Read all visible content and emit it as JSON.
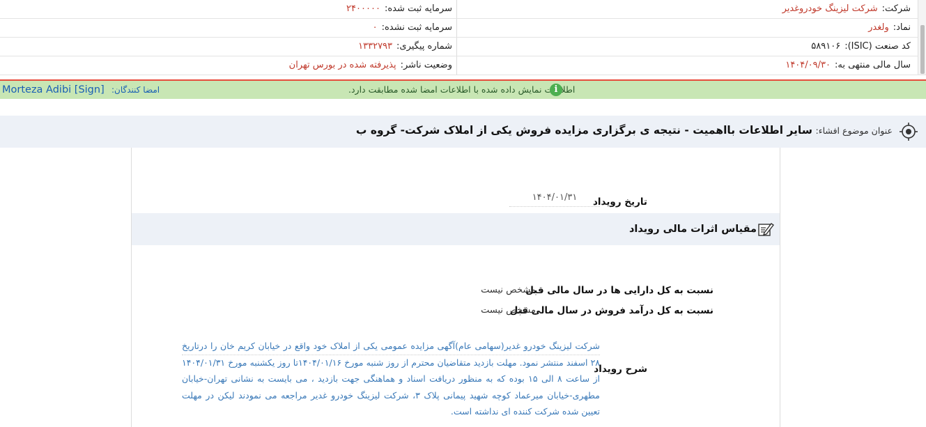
{
  "company_info": {
    "company": {
      "label": "شرکت:",
      "value": "شرکت لیزینگ خودروغدیر"
    },
    "registered_capital": {
      "label": "سرمایه ثبت شده:",
      "value": "۲۴۰۰۰۰۰"
    },
    "symbol": {
      "label": "نماد:",
      "value": "ولغدر"
    },
    "unregistered_capital": {
      "label": "سرمایه ثبت نشده:",
      "value": "۰"
    },
    "isic": {
      "label": "کد صنعت (ISIC):",
      "value": "۵۸۹۱۰۶"
    },
    "tracking_number": {
      "label": "شماره پیگیری:",
      "value": "۱۳۳۲۷۹۳"
    },
    "fiscal_year": {
      "label": "سال مالی منتهی به:",
      "value": "۱۴۰۴/۰۹/۳۰"
    },
    "publisher_status": {
      "label": "وضعیت ناشر:",
      "value": "پذیرفته شده در بورس تهران"
    }
  },
  "verification": {
    "message": "اطلاعات نمایش داده شده با اطلاعات امضا شده مطابقت دارد.",
    "signers_label": "امضا کنندگان:",
    "signer": "Morteza Adibi [Sign]"
  },
  "subject": {
    "label": "عنوان موضوع افشاء:",
    "title": "سایر اطلاعات بااهمیت - نتیجه ی برگزاری مزایده فروش یکی از املاک شرکت- گروه ب"
  },
  "event": {
    "date_label": "تاریخ رویداد",
    "date_value": "۱۴۰۴/۰۱/۳۱",
    "section_title": "مقیاس اثرات مالی رویداد",
    "metrics": [
      {
        "label": "نسبت به کل دارایی ها در سال مالی قبل",
        "value": "مشخص نیست"
      },
      {
        "label": "نسبت به کل درآمد فروش در سال مالی قبل",
        "value": "مشخص نیست"
      }
    ],
    "description_label": "شرح رویداد",
    "description": "شرکت لیزینگ خودرو غدیر(سهامی عام)آگهی مزایده عمومی یکی از املاک خود واقع در خیابان کریم خان را درتاریخ ۲۸ اسفند منتشر نمود. مهلت بازدید متقاضیان محترم از روز شنبه مورخ ۱۴۰۴/۰۱/۱۶تا روز یکشنبه مورخ ۱۴۰۴/۰۱/۳۱ از ساعت ۸ الی ۱۵ بوده که به منظور دریافت اسناد و هماهنگی جهت بازدید ، می بایست به نشانی تهران-خیابان مطهری-خیابان میرعماد کوچه شهید پیمانی پلاک ۳، شرکت لیزینگ خودرو غدیر مراجعه می نمودند لیکن در مهلت تعیین شده شرکت کننده ای نداشته است."
  },
  "colors": {
    "value_red": "#c0392b",
    "verified_bg": "#c8e6b4",
    "alert_line": "#e74c3c",
    "link_blue": "#1a5fb4",
    "description_blue": "#3a79b8",
    "band_bg": "#edf1f7"
  },
  "icons": [
    "info-icon",
    "target-icon",
    "edit-icon"
  ]
}
